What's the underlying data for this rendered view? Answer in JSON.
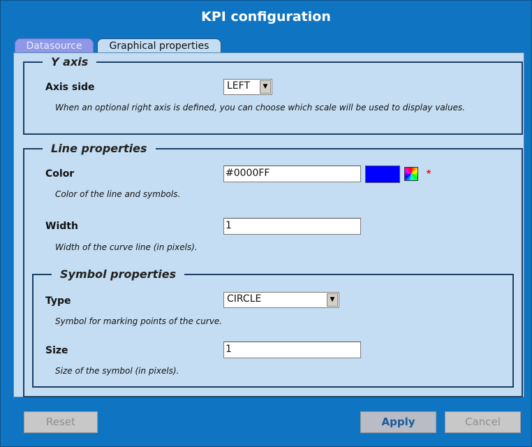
{
  "window": {
    "title": "KPI configuration"
  },
  "tabs": [
    {
      "label": "Datasource",
      "active": false
    },
    {
      "label": "Graphical properties",
      "active": true
    }
  ],
  "y_axis": {
    "legend": "Y axis",
    "axis_side": {
      "label": "Axis side",
      "value": "LEFT",
      "description": "When an optional right axis is defined, you can choose which scale will be used to display values."
    }
  },
  "line_properties": {
    "legend": "Line properties",
    "color": {
      "label": "Color",
      "value": "#0000FF",
      "swatch": "#0000ff",
      "required_mark": "*",
      "description": "Color of the line and symbols."
    },
    "width": {
      "label": "Width",
      "value": "1",
      "description": "Width of the curve line (in pixels)."
    },
    "symbol_properties": {
      "legend": "Symbol properties",
      "type": {
        "label": "Type",
        "value": "CIRCLE",
        "description": "Symbol for marking points of the curve."
      },
      "size": {
        "label": "Size",
        "value": "1",
        "description": "Size of the symbol (in pixels)."
      }
    }
  },
  "buttons": {
    "reset": "Reset",
    "apply": "Apply",
    "cancel": "Cancel"
  },
  "icons": {
    "color_picker": "color-picker-icon",
    "dropdown": "chevron-down-icon"
  },
  "colors": {
    "window_bg": "#0f74c1",
    "panel_bg": "#c4ddf2",
    "required": "#e02020"
  }
}
